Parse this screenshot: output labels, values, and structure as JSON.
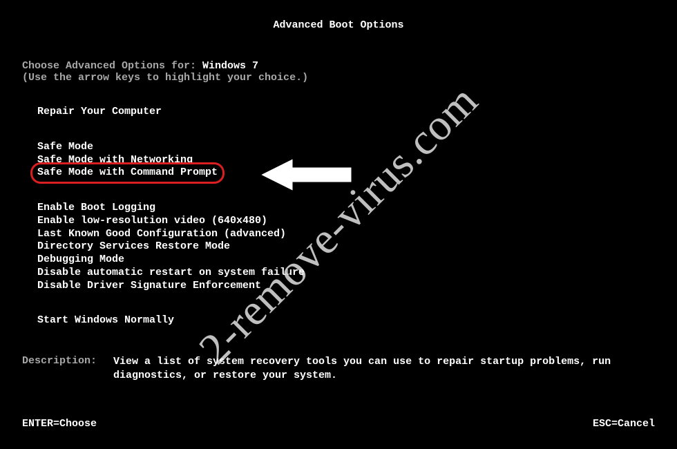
{
  "title": "Advanced Boot Options",
  "instruction": {
    "label": "Choose Advanced Options for: ",
    "value": "Windows 7",
    "hint": "(Use the arrow keys to highlight your choice.)"
  },
  "groups": {
    "repair": "Repair Your Computer",
    "safe": [
      "Safe Mode",
      "Safe Mode with Networking",
      "Safe Mode with Command Prompt"
    ],
    "options": [
      "Enable Boot Logging",
      "Enable low-resolution video (640x480)",
      "Last Known Good Configuration (advanced)",
      "Directory Services Restore Mode",
      "Debugging Mode",
      "Disable automatic restart on system failure",
      "Disable Driver Signature Enforcement"
    ],
    "start": "Start Windows Normally"
  },
  "description": {
    "label": "Description:",
    "text": "View a list of system recovery tools you can use to repair startup problems, run diagnostics, or restore your system."
  },
  "footer": {
    "enter": "ENTER=Choose",
    "esc": "ESC=Cancel"
  },
  "watermark": "2-remove-virus.com",
  "highlight_index": 2
}
